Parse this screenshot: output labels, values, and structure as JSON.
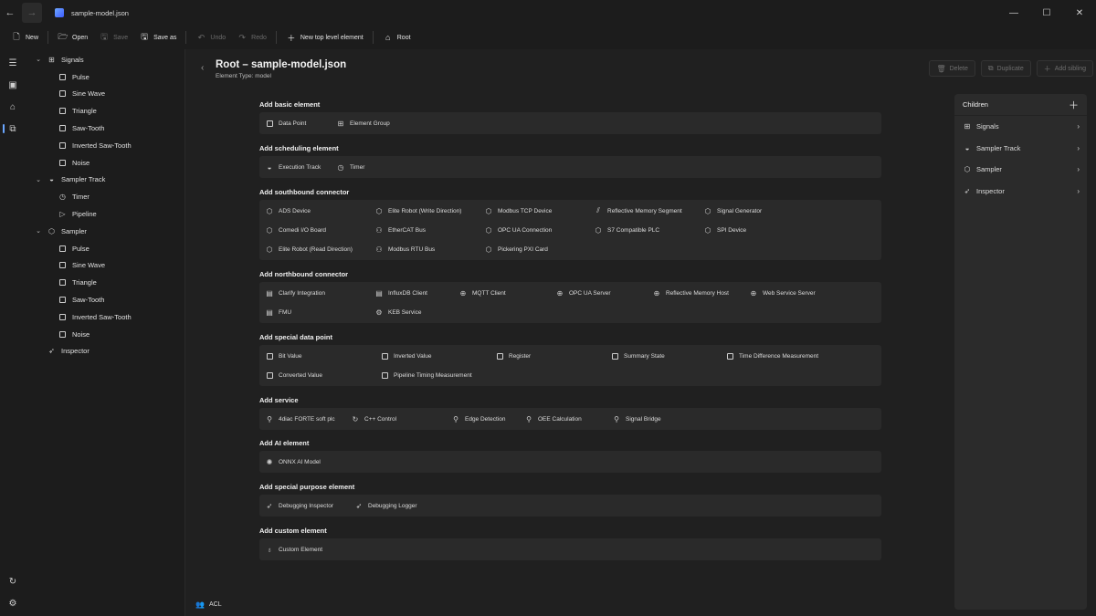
{
  "titlebar": {
    "title": "sample-model.json"
  },
  "toolbar": {
    "new": "New",
    "open": "Open",
    "save": "Save",
    "save_as": "Save as",
    "undo": "Undo",
    "redo": "Redo",
    "new_top_level": "New top level element",
    "root": "Root"
  },
  "tree": {
    "signals": "Signals",
    "signals_children": [
      "Pulse",
      "Sine Wave",
      "Triangle",
      "Saw-Tooth",
      "Inverted Saw-Tooth",
      "Noise"
    ],
    "sampler_track": "Sampler Track",
    "sampler_track_children": [
      "Timer",
      "Pipeline"
    ],
    "sampler": "Sampler",
    "sampler_children": [
      "Pulse",
      "Sine Wave",
      "Triangle",
      "Saw-Tooth",
      "Inverted Saw-Tooth",
      "Noise"
    ],
    "inspector": "Inspector"
  },
  "main": {
    "title": "Root – sample-model.json",
    "subtitle": "Element Type: model",
    "delete": "Delete",
    "duplicate": "Duplicate",
    "add_sibling": "Add sibling",
    "acl": "ACL"
  },
  "sections": [
    {
      "title": "Add basic element",
      "items": [
        "Data Point",
        "Element Group"
      ]
    },
    {
      "title": "Add scheduling element",
      "items": [
        "Execution Track",
        "Timer"
      ]
    },
    {
      "title": "Add southbound connector",
      "items": [
        "ADS Device",
        "Elite Robot (Write Direction)",
        "Modbus TCP Device",
        "Reflective Memory Segment",
        "Signal Generator",
        "Comedi I/O Board",
        "EtherCAT Bus",
        "OPC UA Connection",
        "S7 Compatible PLC",
        "SPI Device",
        "Elite Robot (Read Direction)",
        "Modbus RTU Bus",
        "Pickering PXI Card"
      ]
    },
    {
      "title": "Add northbound connector",
      "items": [
        "Clarify Integration",
        "InfluxDB Client",
        "MQTT Client",
        "OPC UA Server",
        "Reflective Memory Host",
        "Web Service Server",
        "FMU",
        "KEB Service"
      ]
    },
    {
      "title": "Add special data point",
      "items": [
        "Bit Value",
        "Inverted Value",
        "Register",
        "Summary State",
        "Time Difference Measurement",
        "Converted Value",
        "Pipeline Timing Measurement"
      ]
    },
    {
      "title": "Add service",
      "items": [
        "4diac FORTE soft plc",
        "C++ Control",
        "Edge Detection",
        "OEE Calculation",
        "Signal Bridge"
      ]
    },
    {
      "title": "Add AI element",
      "items": [
        "ONNX AI Model"
      ]
    },
    {
      "title": "Add special purpose element",
      "items": [
        "Debugging Inspector",
        "Debugging Logger"
      ]
    },
    {
      "title": "Add custom element",
      "items": [
        "Custom Element"
      ]
    }
  ],
  "children": {
    "title": "Children",
    "items": [
      "Signals",
      "Sampler Track",
      "Sampler",
      "Inspector"
    ]
  }
}
